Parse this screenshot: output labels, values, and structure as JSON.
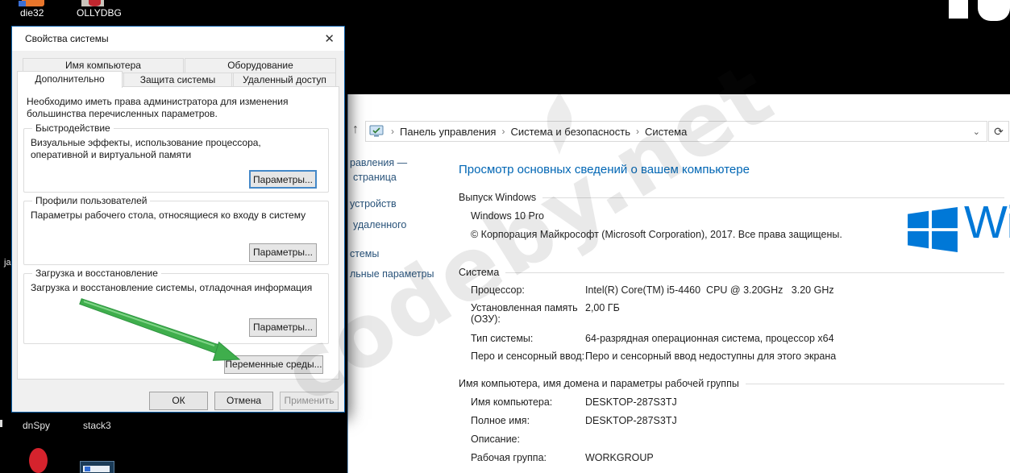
{
  "colors": {
    "accent_blue": "#0078d7",
    "heading_blue": "#0066b4",
    "arrow_green": "#3fae4c",
    "dialog_border": "#0c60a8"
  },
  "icons": {
    "close": "✕",
    "up_arrow": "↑",
    "refresh": "⟳",
    "crumb_sep": "›",
    "dropdown": "⌄"
  },
  "desktop": {
    "icon_die32": "die32",
    "icon_ollydbg": "OLLYDBG",
    "icon_dnspy": "dnSpy",
    "icon_stack3": "stack3",
    "left_fragment": "ja"
  },
  "dialog": {
    "title": "Свойства системы",
    "tabs_back": [
      {
        "label": "Имя компьютера"
      },
      {
        "label": "Оборудование"
      }
    ],
    "tabs_front": [
      {
        "label": "Дополнительно"
      },
      {
        "label": "Защита системы"
      },
      {
        "label": "Удаленный доступ"
      }
    ],
    "intro": "Необходимо иметь права администратора для изменения большинства перечисленных параметров.",
    "groups": [
      {
        "title": "Быстродействие",
        "desc": "Визуальные эффекты, использование процессора, оперативной и виртуальной памяти",
        "button": "Параметры..."
      },
      {
        "title": "Профили пользователей",
        "desc": "Параметры рабочего стола, относящиеся ко входу в систему",
        "button": "Параметры..."
      },
      {
        "title": "Загрузка и восстановление",
        "desc": "Загрузка и восстановление системы, отладочная информация",
        "button": "Параметры..."
      }
    ],
    "env_button": "Переменные среды...",
    "ok": "ОК",
    "cancel": "Отмена",
    "apply": "Применить"
  },
  "window": {
    "breadcrumb": [
      {
        "label": "Панель управления"
      },
      {
        "label": "Система и безопасность"
      },
      {
        "label": "Система"
      }
    ],
    "sidebar_fragments": [
      "равления —",
      "страница",
      "устройств",
      "удаленного",
      "стемы",
      "льные параметры"
    ],
    "heading": "Просмотр основных сведений о вашем компьютере",
    "edition": {
      "title": "Выпуск Windows",
      "product": "Windows 10 Pro",
      "copyright": "© Корпорация Майкрософт (Microsoft Corporation), 2017. Все права защищены."
    },
    "system": {
      "title": "Система",
      "rows": [
        {
          "label": "Процессор:",
          "value": "Intel(R) Core(TM) i5-4460  CPU @ 3.20GHz   3.20 GHz"
        },
        {
          "label": "Установленная память (ОЗУ):",
          "value": "2,00 ГБ"
        },
        {
          "label": "Тип системы:",
          "value": "64-разрядная операционная система, процессор x64"
        },
        {
          "label": "Перо и сенсорный ввод:",
          "value": "Перо и сенсорный ввод недоступны для этого экрана"
        }
      ]
    },
    "computer_name": {
      "title": "Имя компьютера, имя домена и параметры рабочей группы",
      "rows": [
        {
          "label": "Имя компьютера:",
          "value": "DESKTOP-287S3TJ"
        },
        {
          "label": "Полное имя:",
          "value": "DESKTOP-287S3TJ"
        },
        {
          "label": "Описание:",
          "value": ""
        },
        {
          "label": "Рабочая группа:",
          "value": "WORKGROUP"
        }
      ]
    },
    "logo_text": "Wi"
  },
  "watermark": {
    "text": "codeby.net"
  }
}
